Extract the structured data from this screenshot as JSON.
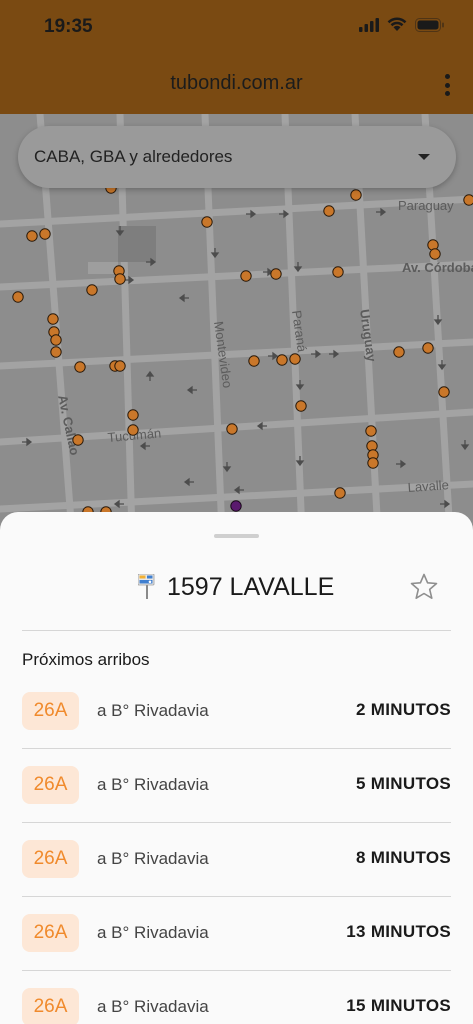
{
  "status_bar": {
    "time": "19:35"
  },
  "browser": {
    "url": "tubondi.com.ar"
  },
  "region_selector": {
    "value": "CABA, GBA y alrededores"
  },
  "map": {
    "street_labels": [
      "Paraguay",
      "Av. Córdoba",
      "Montevideo",
      "Paraná",
      "Uruguay",
      "Av. Callao",
      "Tucumán",
      "Lavalle"
    ]
  },
  "stop": {
    "title": "1597 LAVALLE",
    "section_title": "Próximos arribos",
    "arrivals": [
      {
        "line": "26A",
        "destination": "a B° Rivadavia",
        "eta": "2 MINUTOS"
      },
      {
        "line": "26A",
        "destination": "a B° Rivadavia",
        "eta": "5 MINUTOS"
      },
      {
        "line": "26A",
        "destination": "a B° Rivadavia",
        "eta": "8 MINUTOS"
      },
      {
        "line": "26A",
        "destination": "a B° Rivadavia",
        "eta": "13 MINUTOS"
      },
      {
        "line": "26A",
        "destination": "a B° Rivadavia",
        "eta": "15 MINUTOS"
      }
    ]
  },
  "colors": {
    "header_brown": "#7a4a12",
    "badge_bg": "#fde7d6",
    "badge_text": "#f08a2c",
    "bus_marker": "#c9772a",
    "selected_marker": "#5a1a6e"
  }
}
